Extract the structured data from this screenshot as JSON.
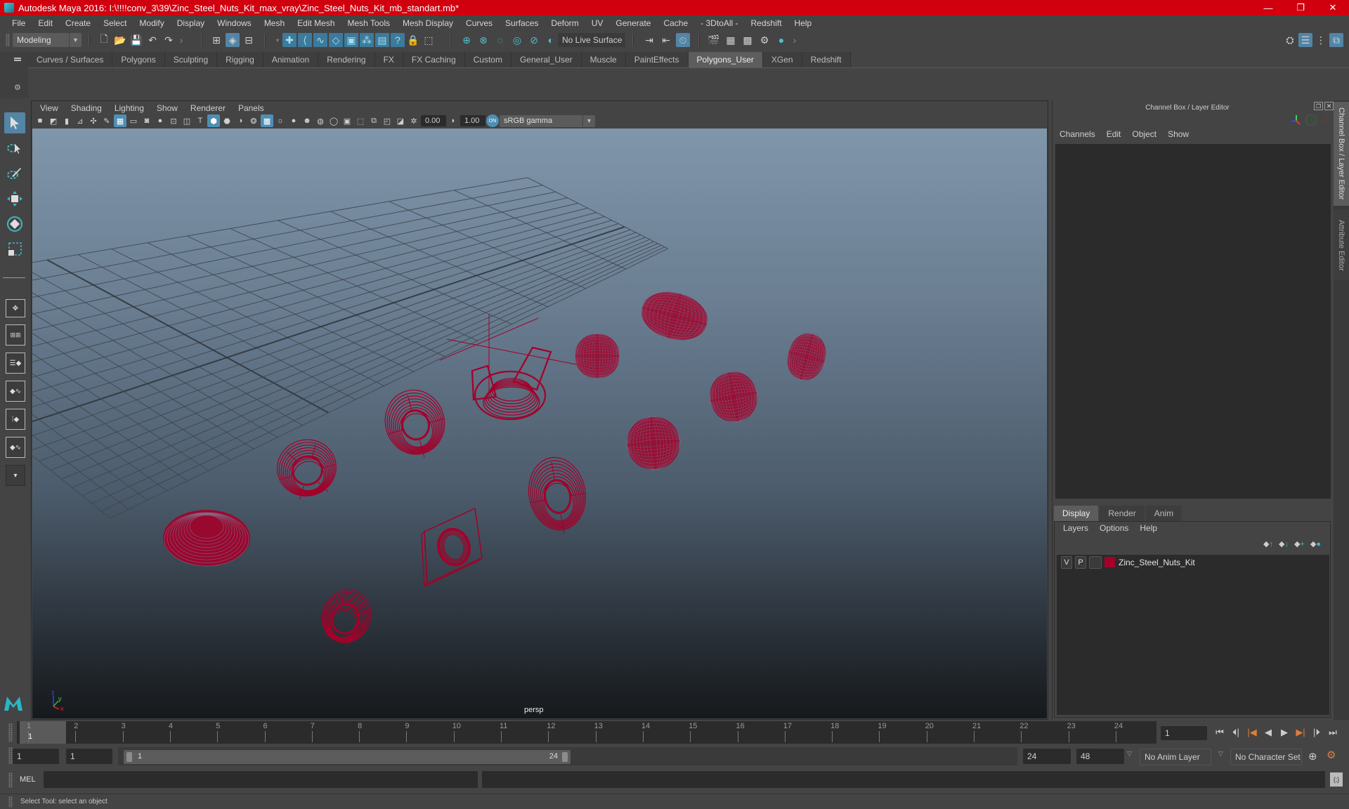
{
  "window": {
    "title": "Autodesk Maya 2016: I:\\!!!!conv_3\\39\\Zinc_Steel_Nuts_Kit_max_vray\\Zinc_Steel_Nuts_Kit_mb_standart.mb*",
    "controls": {
      "minimize": "—",
      "restore": "❐",
      "close": "✕"
    }
  },
  "menubar": [
    "File",
    "Edit",
    "Create",
    "Select",
    "Modify",
    "Display",
    "Windows",
    "Mesh",
    "Edit Mesh",
    "Mesh Tools",
    "Mesh Display",
    "Curves",
    "Surfaces",
    "Deform",
    "UV",
    "Generate",
    "Cache",
    "- 3DtoAll -",
    "Redshift",
    "Help"
  ],
  "toolbar": {
    "mode": "Modeling",
    "live_surface": "No Live Surface"
  },
  "shelf": {
    "tabs": [
      "Curves / Surfaces",
      "Polygons",
      "Sculpting",
      "Rigging",
      "Animation",
      "Rendering",
      "FX",
      "FX Caching",
      "Custom",
      "General_User",
      "Muscle",
      "PaintEffects",
      "Polygons_User",
      "XGen",
      "Redshift"
    ],
    "active_tab": "Polygons_User"
  },
  "viewport": {
    "menu": [
      "View",
      "Shading",
      "Lighting",
      "Show",
      "Renderer",
      "Panels"
    ],
    "exposure": "0.00",
    "gamma": "1.00",
    "color_space": "sRGB gamma",
    "camera_label": "persp",
    "axis_labels": {
      "x": "x",
      "y": "y",
      "z": "z"
    },
    "wire_color": "#a3002a",
    "objects": [
      "wing-nut",
      "cap-nut",
      "long-coupling-nut",
      "thin-round-nut",
      "square-flange-nut",
      "hex-nut",
      "castle-nut-a",
      "castle-nut-b",
      "serrated-flange-nut",
      "square-nut-a",
      "square-nut-b",
      "thin-hex-nut"
    ]
  },
  "channel_box": {
    "title": "Channel Box / Layer Editor",
    "menu": [
      "Channels",
      "Edit",
      "Object",
      "Show"
    ]
  },
  "layer_editor": {
    "tabs": [
      "Display",
      "Render",
      "Anim"
    ],
    "active_tab": "Display",
    "menu": [
      "Layers",
      "Options",
      "Help"
    ],
    "layers": [
      {
        "visible": "V",
        "playback": "P",
        "name": "Zinc_Steel_Nuts_Kit",
        "color": "#a3002a"
      }
    ]
  },
  "side_tabs": [
    "Channel Box / Layer Editor",
    "Attribute Editor"
  ],
  "timeline": {
    "frames": [
      "1",
      "2",
      "3",
      "4",
      "5",
      "6",
      "7",
      "8",
      "9",
      "10",
      "11",
      "12",
      "13",
      "14",
      "15",
      "16",
      "17",
      "18",
      "19",
      "20",
      "21",
      "22",
      "23",
      "24"
    ],
    "current_frame_marker": "1",
    "current_frame": "1"
  },
  "range": {
    "start_time": "1",
    "playback_start": "1",
    "range_start_label": "1",
    "range_end_label": "24",
    "playback_end": "24",
    "end_time": "48",
    "anim_layer": "No Anim Layer",
    "character_set": "No Character Set"
  },
  "command_line": {
    "label": "MEL",
    "input": "",
    "output": ""
  },
  "status": {
    "message": "Select Tool: select an object"
  }
}
